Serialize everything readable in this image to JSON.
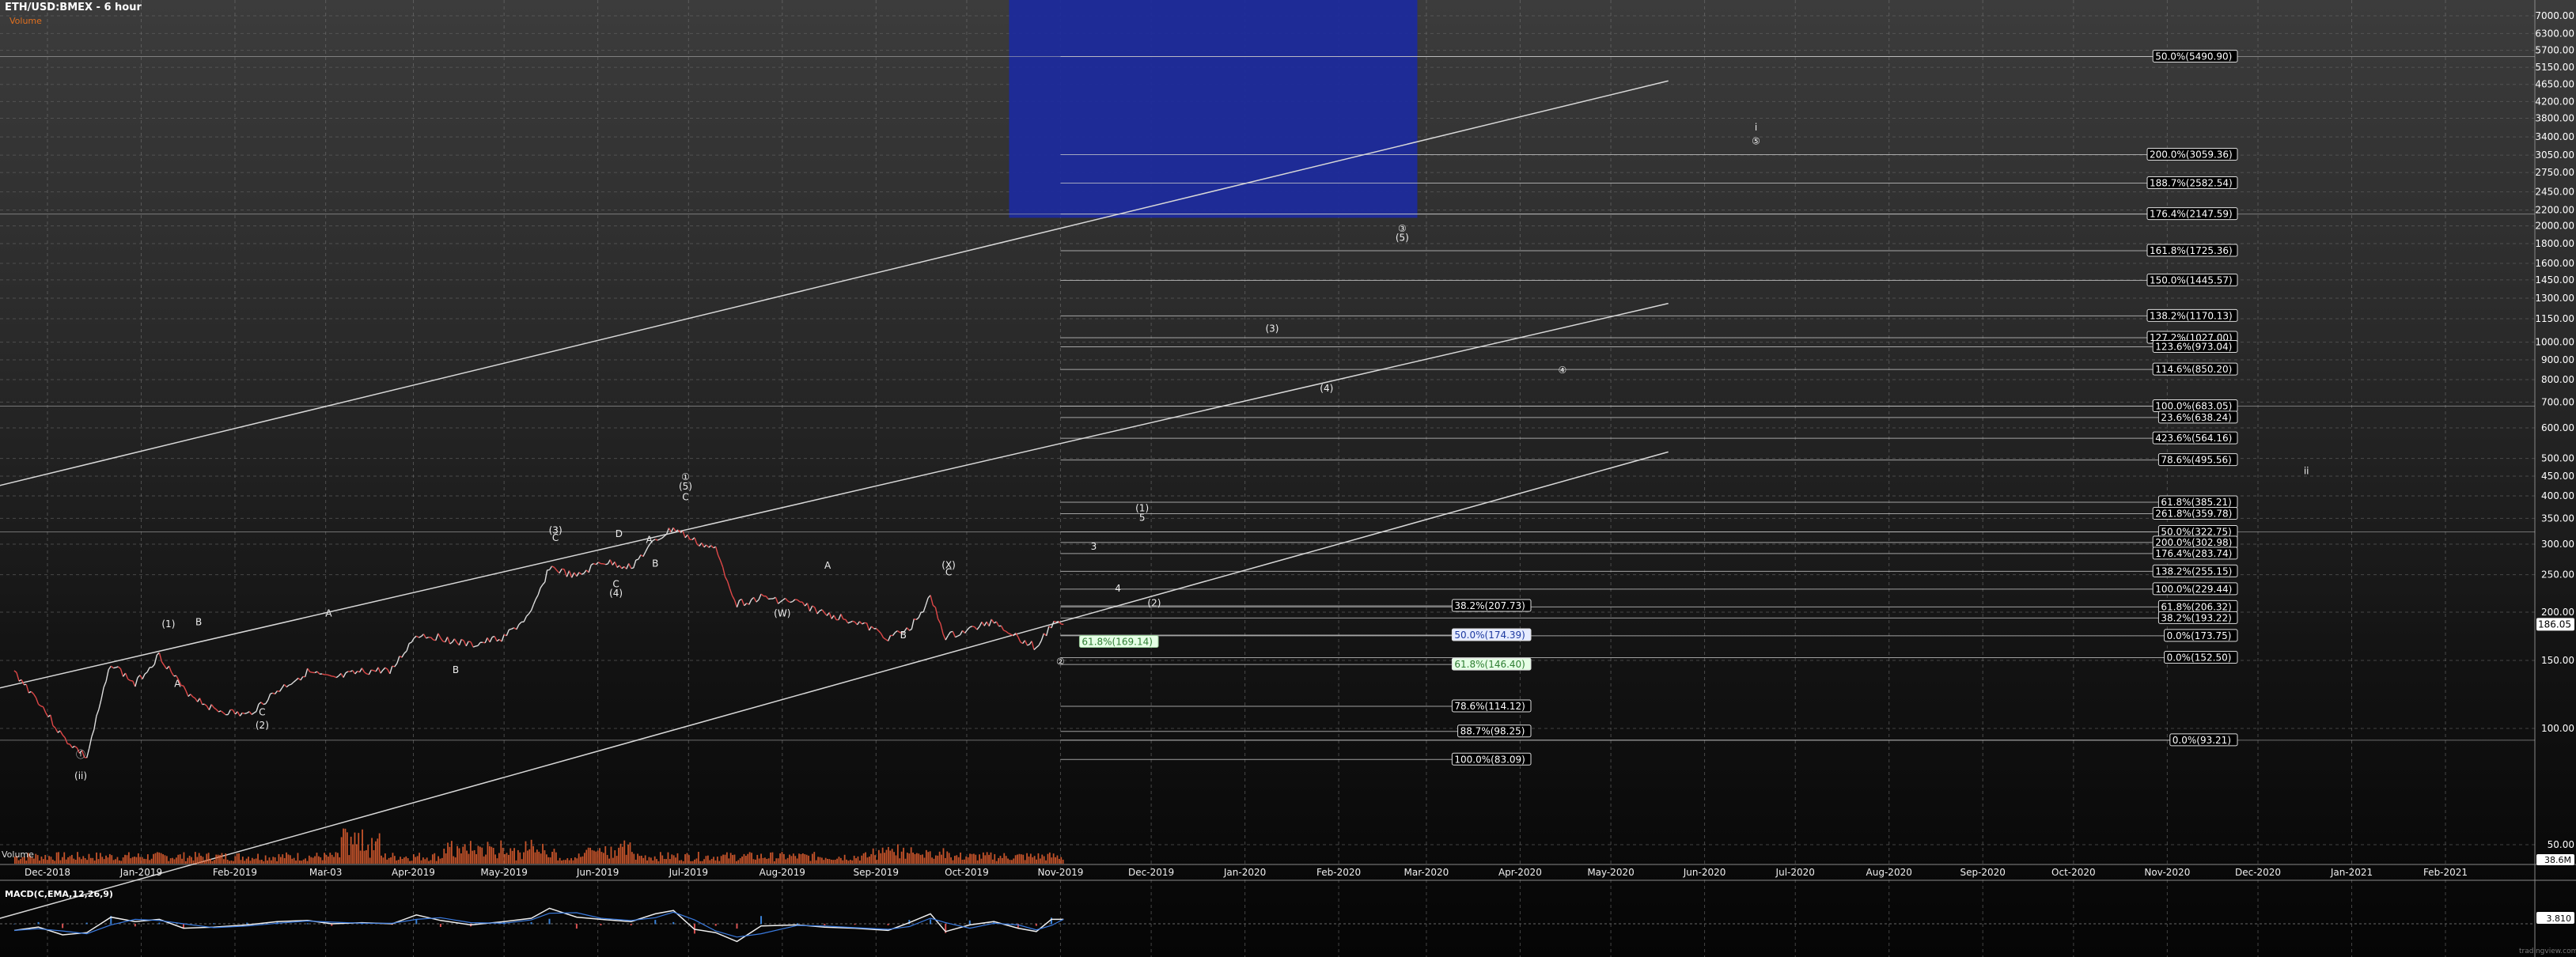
{
  "header": {
    "title": "ETH/USD:BMEX - 6 hour",
    "subtitle": "Volume",
    "volume_label": "Volume",
    "macd_label": "MACD(C,EMA,12,26,9)",
    "watermark": "tradingview.com"
  },
  "chart_data": {
    "type": "line",
    "symbol": "ETH/USD:BMEX",
    "interval": "6 hour",
    "log_scale": true,
    "grid": true,
    "x_ticks": [
      "Dec-2018",
      "Jan-2019",
      "Feb-2019",
      "Mar-03",
      "Apr-2019",
      "May-2019",
      "Jun-2019",
      "Jul-2019",
      "Aug-2019",
      "Sep-2019",
      "Oct-2019",
      "Nov-2019",
      "Dec-2019",
      "Jan-2020",
      "Feb-2020",
      "Mar-2020",
      "Apr-2020",
      "May-2020",
      "Jun-2020",
      "Jul-2020",
      "Aug-2020",
      "Sep-2020",
      "Oct-2020",
      "Nov-2020",
      "Dec-2020",
      "Jan-2021",
      "Feb-2021"
    ],
    "y_ticks": [
      7000,
      6300,
      5700,
      5150,
      4650,
      4200,
      3800,
      3400,
      3050,
      2750,
      2450,
      2200,
      2000,
      1800,
      1600,
      1450,
      1300,
      1150,
      1000,
      900,
      800,
      700,
      600,
      500,
      450,
      400,
      350,
      300,
      250,
      200,
      150,
      100,
      50
    ],
    "price_series": {
      "name": "ETH/USD",
      "x": [
        "Nov-20-2018",
        "Nov-28-2018",
        "Dec-06-2018",
        "Dec-14-2018",
        "Dec-22-2018",
        "Dec-30-2018",
        "Jan-07-2019",
        "Jan-15-2019",
        "Jan-25-2019",
        "Feb-05-2019",
        "Feb-15-2019",
        "Feb-25-2019",
        "Mar-05-2019",
        "Mar-15-2019",
        "Mar-25-2019",
        "Apr-02-2019",
        "Apr-10-2019",
        "Apr-20-2019",
        "May-01-2019",
        "May-10-2019",
        "May-16-2019",
        "May-25-2019",
        "Jun-02-2019",
        "Jun-12-2019",
        "Jun-20-2019",
        "Jun-26-2019",
        "Jul-03-2019",
        "Jul-10-2019",
        "Jul-17-2019",
        "Jul-25-2019",
        "Aug-06-2019",
        "Aug-15-2019",
        "Aug-25-2019",
        "Sep-05-2019",
        "Sep-12-2019",
        "Sep-19-2019",
        "Sep-24-2019",
        "Oct-02-2019",
        "Oct-10-2019",
        "Oct-18-2019",
        "Oct-24-2019",
        "Oct-29-2019",
        "Nov-02-2019"
      ],
      "y": [
        140,
        118,
        95,
        84,
        148,
        130,
        155,
        126,
        112,
        108,
        125,
        140,
        134,
        140,
        142,
        175,
        172,
        164,
        172,
        198,
        262,
        246,
        270,
        262,
        305,
        330,
        305,
        290,
        210,
        218,
        212,
        198,
        190,
        172,
        180,
        218,
        172,
        180,
        190,
        172,
        162,
        185,
        186
      ]
    },
    "volume": {
      "label": "Volume",
      "last_value": "38.6M",
      "min_tick": "50.00"
    },
    "macd": {
      "label": "MACD(C,EMA,12,26,9)",
      "last_value": "3.810",
      "values": [
        -6,
        -3,
        -10,
        -8,
        6,
        2,
        4,
        -4,
        -3,
        -1,
        2,
        3,
        0,
        1,
        0,
        8,
        3,
        -1,
        2,
        5,
        14,
        6,
        4,
        2,
        9,
        12,
        -5,
        -8,
        -16,
        -2,
        -1,
        -3,
        -4,
        -6,
        1,
        9,
        -7,
        -1,
        2,
        -4,
        -7,
        4,
        4
      ]
    },
    "current_price_label": "186.05",
    "target_box": {
      "y_top": 7900,
      "y_bottom": 2100
    },
    "fib_levels": [
      {
        "label": "50.0%(5490.90)",
        "value": 5490.9
      },
      {
        "label": "200.0%(3059.36)",
        "value": 3059.36
      },
      {
        "label": "188.7%(2582.54)",
        "value": 2582.54
      },
      {
        "label": "176.4%(2147.59)",
        "value": 2147.59
      },
      {
        "label": "161.8%(1725.36)",
        "value": 1725.36
      },
      {
        "label": "150.0%(1445.57)",
        "value": 1445.57
      },
      {
        "label": "138.2%(1170.13)",
        "value": 1170.13
      },
      {
        "label": "127.2%(1027.00)",
        "value": 1027.0
      },
      {
        "label": "123.6%(973.04)",
        "value": 973.04
      },
      {
        "label": "114.6%(850.20)",
        "value": 850.2
      },
      {
        "label": "100.0%(683.05)",
        "value": 683.05
      },
      {
        "label": "23.6%(638.24)",
        "value": 638.24
      },
      {
        "label": "423.6%(564.16)",
        "value": 564.16
      },
      {
        "label": "78.6%(495.56)",
        "value": 495.56
      },
      {
        "label": "61.8%(385.21)",
        "value": 385.21
      },
      {
        "label": "261.8%(359.78)",
        "value": 359.78
      },
      {
        "label": "50.0%(322.75)",
        "value": 322.75
      },
      {
        "label": "200.0%(302.98)",
        "value": 302.98
      },
      {
        "label": "176.4%(283.74)",
        "value": 283.74
      },
      {
        "label": "138.2%(255.15)",
        "value": 255.15
      },
      {
        "label": "100.0%(229.44)",
        "value": 229.44
      },
      {
        "label": "61.8%(206.32)",
        "value": 206.32
      },
      {
        "label": "38.2%(193.22)",
        "value": 193.22
      },
      {
        "label": "0.0%(173.75)",
        "value": 173.75
      },
      {
        "label": "0.0%(152.50)",
        "value": 152.5
      },
      {
        "label": "0.0%(93.21)",
        "value": 93.21
      }
    ],
    "mid_fib_levels": [
      {
        "label": "38.2%(207.73)",
        "value": 207.73
      },
      {
        "label": "50.0%(174.39)",
        "value": 174.39
      },
      {
        "label": "61.8%(146.40)",
        "value": 146.4
      },
      {
        "label": "78.6%(114.12)",
        "value": 114.12
      },
      {
        "label": "88.7%(98.25)",
        "value": 98.25
      },
      {
        "label": "100.0%(83.09)",
        "value": 83.09
      }
    ],
    "green_fib_label": {
      "label": "61.8%(169.14)",
      "value": 169.14
    },
    "wave_labels": [
      {
        "text": "①",
        "x": "Jun-30-2019",
        "y": 440
      },
      {
        "text": "(5)",
        "x": "Jun-30-2019",
        "y": 415
      },
      {
        "text": "C",
        "x": "Jun-30-2019",
        "y": 390
      },
      {
        "text": "(1)",
        "x": "Jan-10-2019",
        "y": 183
      },
      {
        "text": "B",
        "x": "Jan-20-2019",
        "y": 185
      },
      {
        "text": "A",
        "x": "Jan-13-2019",
        "y": 128
      },
      {
        "text": "ⓘ",
        "x": "Dec-12-2018",
        "y": 84
      },
      {
        "text": "(ii)",
        "x": "Dec-12-2018",
        "y": 74
      },
      {
        "text": "C",
        "x": "Feb-10-2019",
        "y": 108
      },
      {
        "text": "(2)",
        "x": "Feb-10-2019",
        "y": 100
      },
      {
        "text": "A",
        "x": "Mar-04-2019",
        "y": 195
      },
      {
        "text": "B",
        "x": "Apr-15-2019",
        "y": 139
      },
      {
        "text": "(3)",
        "x": "May-18-2019",
        "y": 320
      },
      {
        "text": "C",
        "x": "May-18-2019",
        "y": 306
      },
      {
        "text": "D",
        "x": "Jun-08-2019",
        "y": 313
      },
      {
        "text": "A",
        "x": "Jun-18-2019",
        "y": 302
      },
      {
        "text": "B",
        "x": "Jun-20-2019",
        "y": 262
      },
      {
        "text": "C",
        "x": "Jun-07-2019",
        "y": 232
      },
      {
        "text": "(4)",
        "x": "Jun-07-2019",
        "y": 220
      },
      {
        "text": "(W)",
        "x": "Aug-01-2019",
        "y": 195
      },
      {
        "text": "A",
        "x": "Aug-16-2019",
        "y": 259
      },
      {
        "text": "B",
        "x": "Sep-10-2019",
        "y": 171
      },
      {
        "text": "(X)",
        "x": "Sep-25-2019",
        "y": 260
      },
      {
        "text": "C",
        "x": "Sep-25-2019",
        "y": 249
      },
      {
        "text": "(1)",
        "x": "Nov-28-2019",
        "y": 365
      },
      {
        "text": "5",
        "x": "Nov-28-2019",
        "y": 345
      },
      {
        "text": "3",
        "x": "Nov-12-2019",
        "y": 290
      },
      {
        "text": "4",
        "x": "Nov-20-2019",
        "y": 226
      },
      {
        "text": "(2)",
        "x": "Dec-02-2019",
        "y": 207
      },
      {
        "text": "②",
        "x": "Nov-01-2019",
        "y": 146
      },
      {
        "text": "(3)",
        "x": "Jan-10-2020",
        "y": 1063
      },
      {
        "text": "(4)",
        "x": "Jan-28-2020",
        "y": 745
      },
      {
        "text": "③",
        "x": "Feb-22-2020",
        "y": 1932
      },
      {
        "text": "(5)",
        "x": "Feb-22-2020",
        "y": 1830
      },
      {
        "text": "④",
        "x": "Apr-15-2020",
        "y": 830
      },
      {
        "text": "i",
        "x": "Jun-18-2020",
        "y": 3530
      },
      {
        "text": "⑤",
        "x": "Jun-18-2020",
        "y": 3250
      },
      {
        "text": "ii",
        "x": "Dec-17-2020",
        "y": 455
      }
    ],
    "trend_lines": [
      {
        "x1": "Nov-01-2018",
        "y1": 400,
        "x2": "May-20-2020",
        "y2": 4750
      },
      {
        "x1": "Nov-01-2018",
        "y1": 120,
        "x2": "May-20-2020",
        "y2": 1260
      },
      {
        "x1": "Nov-01-2018",
        "y1": 30,
        "x2": "May-20-2020",
        "y2": 520
      }
    ],
    "colors": {
      "price_up": "#dddddd",
      "price_down": "#e04848",
      "target_box": "#1c2a9e",
      "volume": "#e56030",
      "green_label": "#2e7d32",
      "blue_label": "#1d3aa0"
    }
  }
}
